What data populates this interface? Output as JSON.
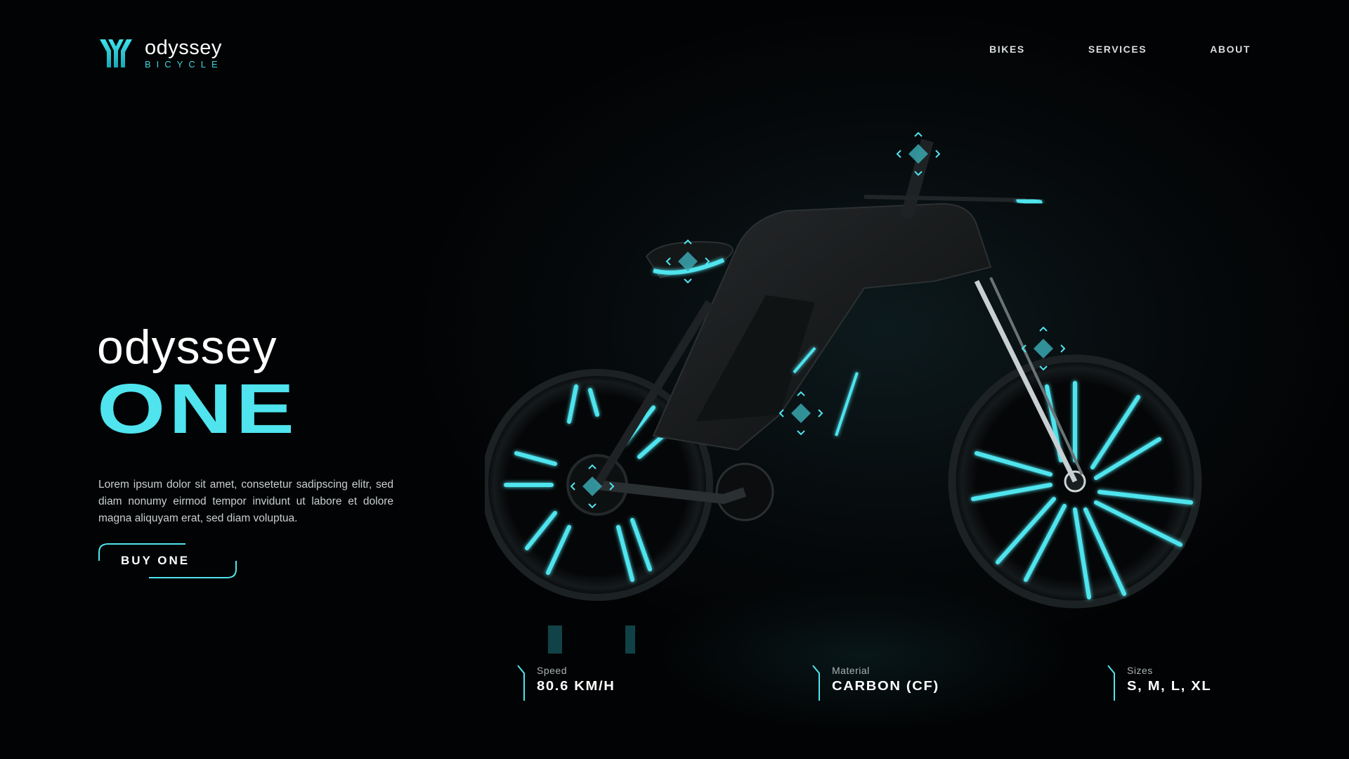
{
  "brand": {
    "name": "odyssey",
    "tagline": "BICYCLE",
    "accent_color": "#4fe4ee"
  },
  "nav": {
    "items": [
      {
        "label": "BIKES"
      },
      {
        "label": "SERVICES"
      },
      {
        "label": "ABOUT"
      }
    ]
  },
  "hero": {
    "title_line1": "odyssey",
    "title_line2": "ONE",
    "description": "Lorem ipsum dolor sit amet, consetetur sadipscing elitr, sed diam nonumy eirmod tempor invidunt ut labore et dolore magna aliquyam erat, sed diam voluptua.",
    "cta_label": "BUY ONE"
  },
  "hotspots": [
    {
      "name": "handlebar-hotspot",
      "icon": "diamond-move-icon"
    },
    {
      "name": "saddle-hotspot",
      "icon": "diamond-move-icon"
    },
    {
      "name": "fork-hotspot",
      "icon": "diamond-move-icon"
    },
    {
      "name": "frame-hotspot",
      "icon": "diamond-move-icon"
    },
    {
      "name": "rear-hub-hotspot",
      "icon": "diamond-move-icon"
    }
  ],
  "specs": [
    {
      "label": "Speed",
      "value": "80.6 KM/H"
    },
    {
      "label": "Material",
      "value": "CARBON (CF)"
    },
    {
      "label": "Sizes",
      "value": "S, M, L, XL"
    }
  ]
}
